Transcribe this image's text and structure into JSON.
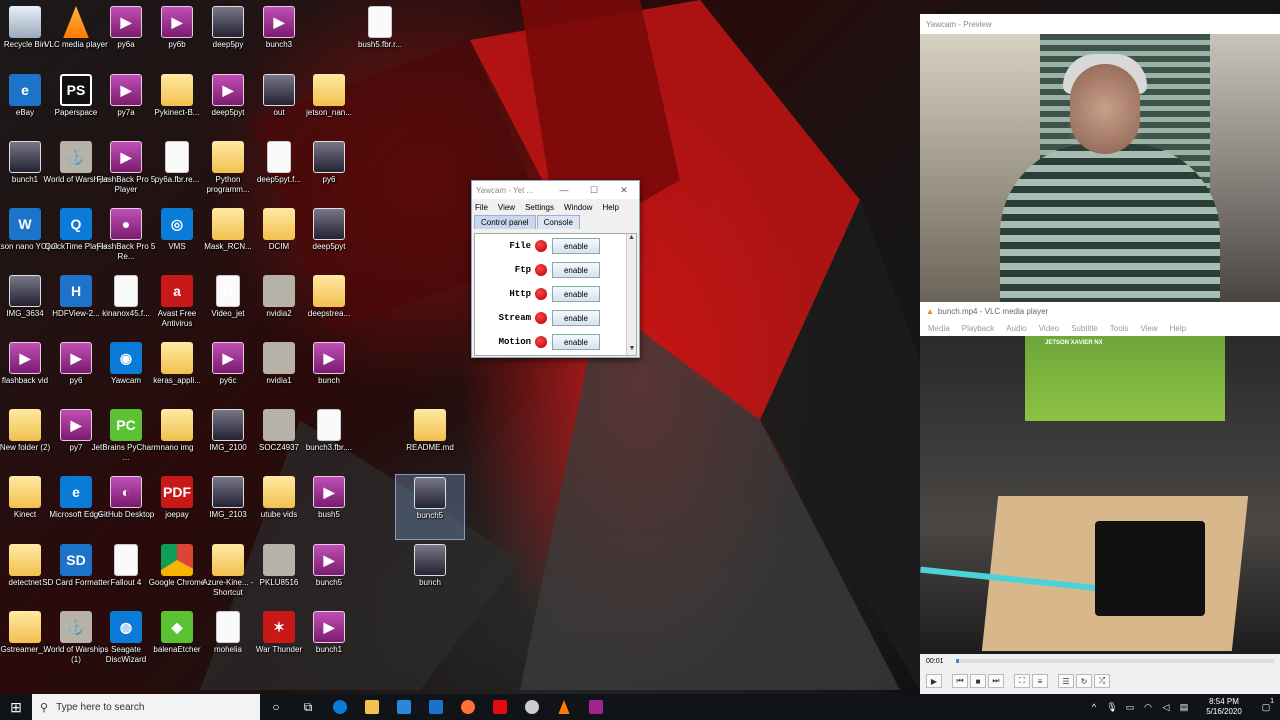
{
  "desktop": {
    "icons": [
      {
        "label": "Recycle Bin",
        "kind": "bin",
        "glyph": ""
      },
      {
        "label": "VLC media player",
        "kind": "vlc",
        "glyph": ""
      },
      {
        "label": "py6a",
        "kind": "vid",
        "glyph": "▶"
      },
      {
        "label": "py6b",
        "kind": "vid",
        "glyph": "▶"
      },
      {
        "label": "deep5py",
        "kind": "img",
        "glyph": ""
      },
      {
        "label": "bunch3",
        "kind": "vid",
        "glyph": "▶"
      },
      {
        "label": "bush5.fbr.r...",
        "kind": "file",
        "glyph": ""
      },
      {
        "label": "eBay",
        "kind": "app",
        "glyph": "e"
      },
      {
        "label": "Paperspace",
        "kind": "ps",
        "glyph": "PS"
      },
      {
        "label": "py7a",
        "kind": "vid",
        "glyph": "▶"
      },
      {
        "label": "Pykinect-B...",
        "kind": "folder",
        "glyph": ""
      },
      {
        "label": "deep5pyt",
        "kind": "vid",
        "glyph": "▶"
      },
      {
        "label": "out",
        "kind": "img",
        "glyph": ""
      },
      {
        "label": "jetson_nan...",
        "kind": "folder",
        "glyph": ""
      },
      {
        "label": "bunch1",
        "kind": "img",
        "glyph": ""
      },
      {
        "label": "World of Warships",
        "kind": "gray",
        "glyph": "⚓"
      },
      {
        "label": "FlashBack Pro 5 Player",
        "kind": "vid",
        "glyph": "▶"
      },
      {
        "label": "py6a.fbr.re...",
        "kind": "file",
        "glyph": ""
      },
      {
        "label": "Python programm...",
        "kind": "folder",
        "glyph": ""
      },
      {
        "label": "deep5pyt.f...",
        "kind": "file",
        "glyph": ""
      },
      {
        "label": "py6",
        "kind": "img",
        "glyph": ""
      },
      {
        "label": "jetson nano YOLO",
        "kind": "app",
        "glyph": "W"
      },
      {
        "label": "QuickTime Player",
        "kind": "edge",
        "glyph": "Q"
      },
      {
        "label": "FlashBack Pro 5 Re...",
        "kind": "vid",
        "glyph": "●"
      },
      {
        "label": "VMS",
        "kind": "edge",
        "glyph": "◎"
      },
      {
        "label": "Mask_RCN...",
        "kind": "folder",
        "glyph": ""
      },
      {
        "label": "DCIM",
        "kind": "folder",
        "glyph": ""
      },
      {
        "label": "deep5pyt",
        "kind": "img",
        "glyph": ""
      },
      {
        "label": "IMG_3634",
        "kind": "img",
        "glyph": ""
      },
      {
        "label": "HDFView-2...",
        "kind": "app",
        "glyph": "H"
      },
      {
        "label": "kinanox45.f...",
        "kind": "file",
        "glyph": ""
      },
      {
        "label": "Avast Free Antivirus",
        "kind": "red",
        "glyph": "a"
      },
      {
        "label": "Video_jet",
        "kind": "file",
        "glyph": "G"
      },
      {
        "label": "nvidia2",
        "kind": "gray",
        "glyph": ""
      },
      {
        "label": "deepstrea...",
        "kind": "folder",
        "glyph": ""
      },
      {
        "label": "flashback vid",
        "kind": "vid",
        "glyph": "▶"
      },
      {
        "label": "py6",
        "kind": "vid",
        "glyph": "▶"
      },
      {
        "label": "Yawcam",
        "kind": "edge",
        "glyph": "◉"
      },
      {
        "label": "keras_appli...",
        "kind": "folder",
        "glyph": ""
      },
      {
        "label": "py6c",
        "kind": "vid",
        "glyph": "▶"
      },
      {
        "label": "nvidia1",
        "kind": "gray",
        "glyph": ""
      },
      {
        "label": "bunch",
        "kind": "vid",
        "glyph": "▶"
      },
      {
        "label": "New folder (2)",
        "kind": "folder",
        "glyph": ""
      },
      {
        "label": "py7",
        "kind": "vid",
        "glyph": "▶"
      },
      {
        "label": "JetBrains PyCharm ...",
        "kind": "green",
        "glyph": "PC"
      },
      {
        "label": "nano img",
        "kind": "folder",
        "glyph": ""
      },
      {
        "label": "IMG_2100",
        "kind": "img",
        "glyph": ""
      },
      {
        "label": "SOCZ4937",
        "kind": "gray",
        "glyph": ""
      },
      {
        "label": "bunch3.fbr....",
        "kind": "file",
        "glyph": ""
      },
      {
        "label": "Kinect",
        "kind": "folder",
        "glyph": ""
      },
      {
        "label": "Microsoft Edge",
        "kind": "edge",
        "glyph": "e"
      },
      {
        "label": "GitHub Desktop",
        "kind": "vid",
        "glyph": "◐"
      },
      {
        "label": "joepay",
        "kind": "red",
        "glyph": "PDF"
      },
      {
        "label": "IMG_2103",
        "kind": "img",
        "glyph": ""
      },
      {
        "label": "utube vids",
        "kind": "folder",
        "glyph": ""
      },
      {
        "label": "bush5",
        "kind": "vid",
        "glyph": "▶"
      },
      {
        "label": "detectnet",
        "kind": "folder",
        "glyph": ""
      },
      {
        "label": "SD Card Formatter",
        "kind": "app",
        "glyph": "SD"
      },
      {
        "label": "Fallout 4",
        "kind": "file",
        "glyph": ""
      },
      {
        "label": "Google Chrome",
        "kind": "chrome",
        "glyph": ""
      },
      {
        "label": "Azure-Kine... - Shortcut",
        "kind": "folder",
        "glyph": ""
      },
      {
        "label": "PKLU8516",
        "kind": "gray",
        "glyph": ""
      },
      {
        "label": "bunch5",
        "kind": "vid",
        "glyph": "▶"
      },
      {
        "label": "Gstreamer_...",
        "kind": "folder",
        "glyph": ""
      },
      {
        "label": "World of Warships (1)",
        "kind": "gray",
        "glyph": "⚓"
      },
      {
        "label": "Seagate DiscWizard",
        "kind": "edge",
        "glyph": "◍"
      },
      {
        "label": "balenaEtcher",
        "kind": "green",
        "glyph": "◆"
      },
      {
        "label": "mohelia",
        "kind": "file",
        "glyph": ""
      },
      {
        "label": "War Thunder",
        "kind": "red",
        "glyph": "✶"
      },
      {
        "label": "bunch1",
        "kind": "vid",
        "glyph": "▶"
      },
      {
        "label": "README.md",
        "kind": "folder",
        "glyph": ""
      },
      {
        "label": "bunch5",
        "kind": "img",
        "glyph": ""
      },
      {
        "label": "bunch",
        "kind": "img",
        "glyph": ""
      },
      {
        "label": "bunch4",
        "kind": "img",
        "glyph": ""
      }
    ]
  },
  "yawcam_cp": {
    "title": "Yawcam - Yet ...",
    "menu": [
      "File",
      "View",
      "Settings",
      "Window",
      "Help"
    ],
    "tabs": [
      "Control panel",
      "Console"
    ],
    "rows": [
      {
        "label": "File",
        "button": "enable"
      },
      {
        "label": "Ftp",
        "button": "enable"
      },
      {
        "label": "Http",
        "button": "enable"
      },
      {
        "label": "Stream",
        "button": "enable"
      },
      {
        "label": "Motion",
        "button": "enable"
      }
    ]
  },
  "preview": {
    "title": "Yawcam - Preview"
  },
  "vlc": {
    "title": "bunch.mp4 - VLC media player",
    "menu": [
      "Media",
      "Playback",
      "Audio",
      "Video",
      "Subtitle",
      "Tools",
      "View",
      "Help"
    ],
    "box_text": "JETSON XAVIER NX",
    "time": "00:01",
    "progress": 0.01
  },
  "taskbar": {
    "search_placeholder": "Type here to search",
    "time": "8:54 PM",
    "date": "5/16/2020",
    "notifications": "1"
  },
  "colors": {
    "accent": "#0a7bd6",
    "vlc_orange": "#ff7b00",
    "status_red": "#c00000"
  }
}
